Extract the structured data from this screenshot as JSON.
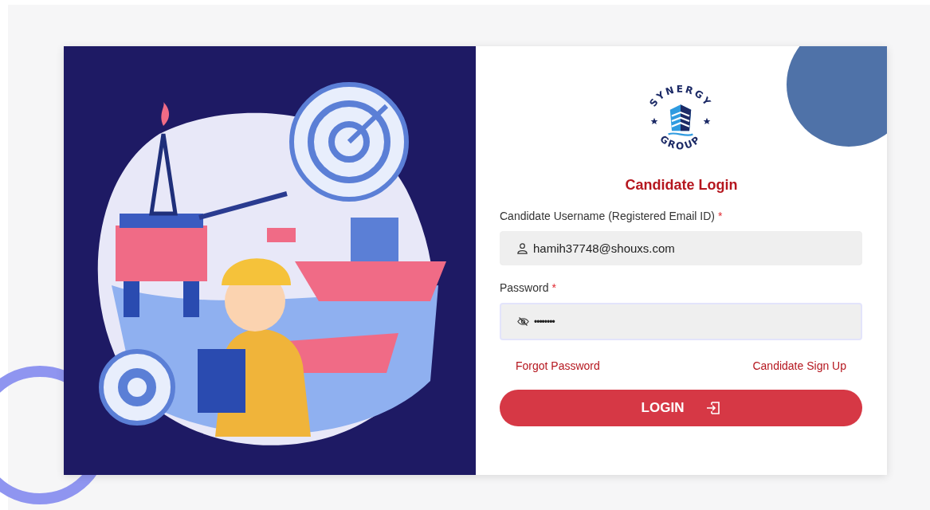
{
  "logo": {
    "top_text": "SYNERGY",
    "bottom_text": "GROUP"
  },
  "title": "Candidate Login",
  "fields": [
    {
      "kind": "user",
      "label": "Candidate Username (Registered Email ID)",
      "required_mark": "*",
      "value": "hamih37748@shouxs.com",
      "focused": false
    },
    {
      "kind": "password",
      "label": "Password",
      "required_mark": "*",
      "value": "••••••••",
      "focused": true
    }
  ],
  "links": [
    "Forgot Password",
    "Candidate Sign Up"
  ],
  "login_button": {
    "label": "LOGIN"
  }
}
